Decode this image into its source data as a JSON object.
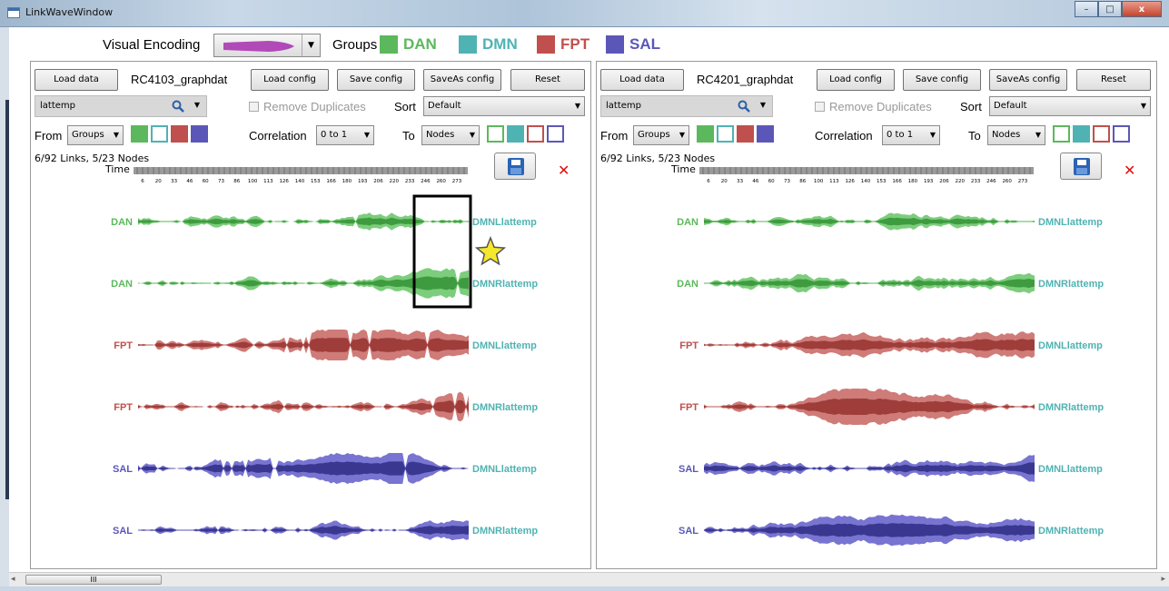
{
  "window": {
    "title": "LinkWaveWindow",
    "controls": [
      "–",
      "□",
      "x"
    ]
  },
  "encoding_bar": {
    "label": "Visual Encoding",
    "groups_label": "Groups",
    "groups": [
      {
        "name": "DAN",
        "color": "#5cb85c"
      },
      {
        "name": "DMN",
        "color": "#4fb3b3"
      },
      {
        "name": "FPT",
        "color": "#c0504d"
      },
      {
        "name": "SAL",
        "color": "#5b57b8"
      }
    ]
  },
  "panels": [
    {
      "load_data_label": "Load data",
      "dataset_name": "RC4103_graphdat",
      "load_config_label": "Load config",
      "save_config_label": "Save config",
      "saveas_config_label": "SaveAs config",
      "reset_label": "Reset",
      "search_value": "lattemp",
      "remove_duplicates_label": "Remove Duplicates",
      "sort_label": "Sort",
      "sort_value": "Default",
      "from_label": "From",
      "from_value": "Groups",
      "correlation_label": "Correlation",
      "correlation_value": "0 to 1",
      "to_label": "To",
      "to_value": "Nodes",
      "stats": "6/92 Links,  5/23 Nodes",
      "time_label": "Time",
      "ticks": [
        "6",
        "20",
        "33",
        "46",
        "60",
        "73",
        "86",
        "100",
        "113",
        "126",
        "140",
        "153",
        "166",
        "180",
        "193",
        "206",
        "220",
        "233",
        "246",
        "260",
        "273"
      ],
      "rows": [
        {
          "from": "DAN",
          "to": "DMNLlattemp",
          "group": "DAN"
        },
        {
          "from": "DAN",
          "to": "DMNRlattemp",
          "group": "DAN"
        },
        {
          "from": "FPT",
          "to": "DMNLlattemp",
          "group": "FPT"
        },
        {
          "from": "FPT",
          "to": "DMNRlattemp",
          "group": "FPT"
        },
        {
          "from": "SAL",
          "to": "DMNLlattemp",
          "group": "SAL"
        },
        {
          "from": "SAL",
          "to": "DMNRlattemp",
          "group": "SAL"
        }
      ]
    },
    {
      "load_data_label": "Load data",
      "dataset_name": "RC4201_graphdat",
      "load_config_label": "Load config",
      "save_config_label": "Save config",
      "saveas_config_label": "SaveAs config",
      "reset_label": "Reset",
      "search_value": "lattemp",
      "remove_duplicates_label": "Remove Duplicates",
      "sort_label": "Sort",
      "sort_value": "Default",
      "from_label": "From",
      "from_value": "Groups",
      "correlation_label": "Correlation",
      "correlation_value": "0 to 1",
      "to_label": "To",
      "to_value": "Nodes",
      "stats": "6/92 Links,  5/23 Nodes",
      "time_label": "Time",
      "ticks": [
        "6",
        "20",
        "33",
        "46",
        "60",
        "73",
        "86",
        "100",
        "113",
        "126",
        "140",
        "153",
        "166",
        "180",
        "193",
        "206",
        "220",
        "233",
        "246",
        "260",
        "273"
      ],
      "rows": [
        {
          "from": "DAN",
          "to": "DMNLlattemp",
          "group": "DAN"
        },
        {
          "from": "DAN",
          "to": "DMNRlattemp",
          "group": "DAN"
        },
        {
          "from": "FPT",
          "to": "DMNLlattemp",
          "group": "FPT"
        },
        {
          "from": "FPT",
          "to": "DMNRlattemp",
          "group": "FPT"
        },
        {
          "from": "SAL",
          "to": "DMNLlattemp",
          "group": "SAL"
        },
        {
          "from": "SAL",
          "to": "DMNRlattemp",
          "group": "SAL"
        }
      ]
    }
  ],
  "scrollbar": {
    "thumb_label": "III"
  },
  "colors": {
    "DAN_light": "#7ccd7c",
    "DAN_dark": "#3f9b3f",
    "FPT_light": "#cf7b78",
    "FPT_dark": "#9e3d3a",
    "SAL_light": "#7874d1",
    "SAL_dark": "#3a3790",
    "target_text": "#4fb3b3"
  }
}
